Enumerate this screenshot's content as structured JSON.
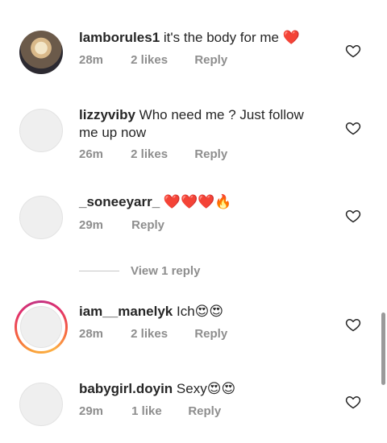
{
  "comments": [
    {
      "username": "lamborules1",
      "text": "it's the body for me",
      "emoji": "❤️",
      "time": "28m",
      "likes": "2 likes",
      "reply": "Reply"
    },
    {
      "username": "lizzyviby",
      "text": "Who need me ? Just follow me up now",
      "emoji": "",
      "time": "26m",
      "likes": "2 likes",
      "reply": "Reply"
    },
    {
      "username": "_soneeyarr_",
      "text": "",
      "emoji": "❤️❤️❤️🔥",
      "time": "29m",
      "likes": "",
      "reply": "Reply"
    },
    {
      "username": "iam__manelyk",
      "text": "Ich",
      "emoji": "😍😍",
      "time": "28m",
      "likes": "2 likes",
      "reply": "Reply"
    },
    {
      "username": "babygirl.doyin",
      "text": "Sexy",
      "emoji": "😍😍",
      "time": "29m",
      "likes": "1 like",
      "reply": "Reply"
    }
  ],
  "view_replies": {
    "label": "View 1 reply"
  },
  "icons": {
    "like": "heart-outline-icon"
  }
}
